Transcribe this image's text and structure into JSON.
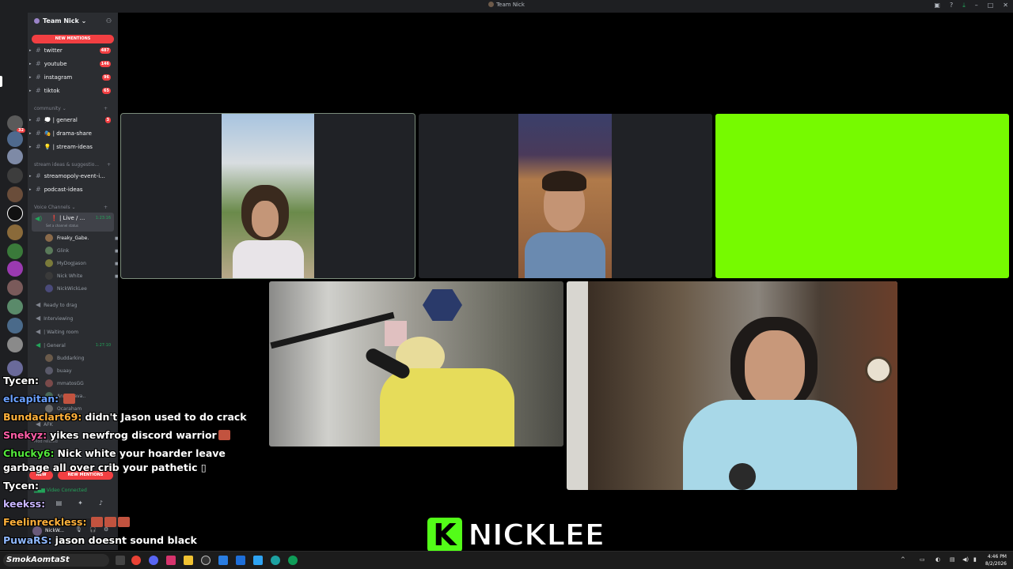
{
  "window": {
    "title": "Team Nick"
  },
  "server": {
    "name": "Team Nick",
    "new_mentions": "NEW MENTIONS",
    "channels_top": [
      {
        "name": "twitter",
        "count": "487"
      },
      {
        "name": "youtube",
        "count": "146"
      },
      {
        "name": "instagram",
        "count": "96"
      },
      {
        "name": "tiktok",
        "count": "65"
      }
    ],
    "cat_community": "community",
    "channels_community": [
      {
        "name": "💭 | general",
        "count": "3"
      },
      {
        "name": "🎭 | drama-share",
        "count": ""
      },
      {
        "name": "💡 | stream-ideas",
        "count": ""
      }
    ],
    "cat_stream": "stream ideas & suggestio...",
    "channels_stream": [
      {
        "name": "streamopoly-event-i..."
      },
      {
        "name": "podcast-ideas"
      }
    ],
    "cat_voice": "Voice Channels",
    "live_channel": {
      "name": "❗ | Live / ...",
      "time": "1:23:16",
      "status": "Set a channel status"
    },
    "voice_users": [
      "Freaky_Gabe.",
      "Glink",
      "MyDogJason",
      "Nick White",
      "NickWickLee"
    ],
    "voice_rows": [
      {
        "name": "Ready to drag"
      },
      {
        "name": "Interviewing"
      },
      {
        "name": "| Waiting room"
      },
      {
        "name": "| General",
        "time": "1:27:10"
      }
    ],
    "general_users": [
      "Buddarking",
      "buaay",
      "mmatosGG",
      "Annccsava..",
      "Ocaraham"
    ],
    "afk": "AFK",
    "mod_related": "Mod related",
    "new_label": "NEW",
    "video_connected": "Video Connected",
    "self_name": "NickW..."
  },
  "chat": [
    {
      "user": "Tycen:",
      "color": "#ffffff",
      "text": ""
    },
    {
      "user": "elcapitan:",
      "color": "#6aa0ff",
      "text": ""
    },
    {
      "user": "Bundaclart69:",
      "color": "#ffb13b",
      "text": "didn't Jason used to do crack"
    },
    {
      "user": "Snekyz:",
      "color": "#ff5ea8",
      "text": "yikes newfrog discord warrior"
    },
    {
      "user": "Chucky6:",
      "color": "#53e83b",
      "text": "Nick white your hoarder leave garbage all over crib your pathetic ▯"
    },
    {
      "user": "Tycen:",
      "color": "#ffffff",
      "text": ""
    },
    {
      "user": "keekss:",
      "color": "#c9b6ff",
      "text": ""
    },
    {
      "user": "Feelinreckless:",
      "color": "#ffb13b",
      "text": ""
    },
    {
      "user": "PuwaRS:",
      "color": "#8fb8ff",
      "text": "jason doesnt sound black"
    }
  ],
  "branding": {
    "logo_letter": "K",
    "name": "NICKLEE"
  },
  "taskbar": {
    "search": "SmokAomtaSt",
    "time": "4:46 PM",
    "date": "8/2/2026"
  },
  "colors": {
    "kick_green": "#53fc18",
    "discord_bg": "#2b2d31",
    "mention_red": "#f23f42"
  }
}
